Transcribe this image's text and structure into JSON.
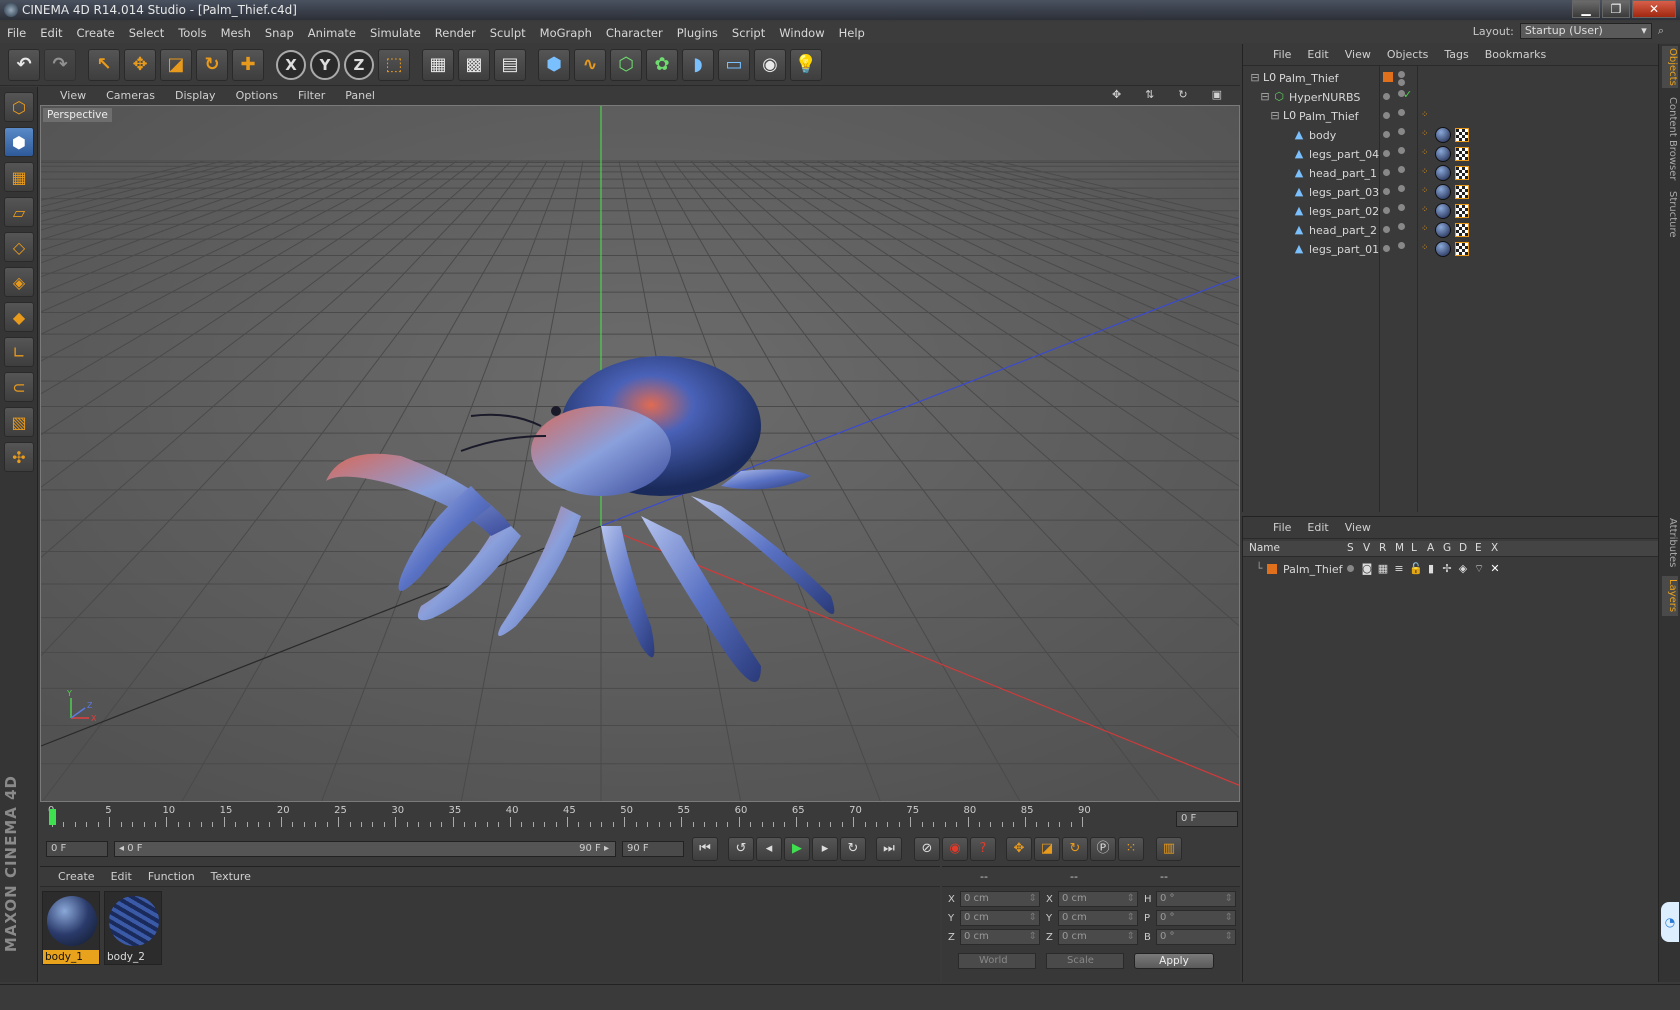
{
  "window": {
    "title": "CINEMA 4D R14.014 Studio - [Palm_Thief.c4d]",
    "min": "▁",
    "max": "❐",
    "close": "✕"
  },
  "menu": [
    "File",
    "Edit",
    "Create",
    "Select",
    "Tools",
    "Mesh",
    "Snap",
    "Animate",
    "Simulate",
    "Render",
    "Sculpt",
    "MoGraph",
    "Character",
    "Plugins",
    "Script",
    "Window",
    "Help"
  ],
  "layout": {
    "label": "Layout:",
    "value": "Startup (User)"
  },
  "viewport": {
    "menu": [
      "View",
      "Cameras",
      "Display",
      "Options",
      "Filter",
      "Panel"
    ],
    "camera_label": "Perspective",
    "axis_labels": {
      "x": "X",
      "y": "Y",
      "z": "Z"
    }
  },
  "timeline": {
    "ticks": [
      "0",
      "5",
      "10",
      "15",
      "20",
      "25",
      "30",
      "35",
      "40",
      "45",
      "50",
      "55",
      "60",
      "65",
      "70",
      "75",
      "80",
      "85",
      "90"
    ],
    "current_frame": "0 F",
    "start_field": "0 F",
    "range_start": "◂ 0 F",
    "range_end": "90 F ▸",
    "end_field": "90 F"
  },
  "materials": {
    "menu": [
      "Create",
      "Edit",
      "Function",
      "Texture"
    ],
    "items": [
      {
        "name": "body_1",
        "selected": true
      },
      {
        "name": "body_2",
        "selected": false
      }
    ]
  },
  "coordinates": {
    "headers": [
      "--",
      "--",
      "--"
    ],
    "rows": [
      {
        "a1": "X",
        "v1": "0 cm",
        "a2": "X",
        "v2": "0 cm",
        "a3": "H",
        "v3": "0 °"
      },
      {
        "a1": "Y",
        "v1": "0 cm",
        "a2": "Y",
        "v2": "0 cm",
        "a3": "P",
        "v3": "0 °"
      },
      {
        "a1": "Z",
        "v1": "0 cm",
        "a2": "Z",
        "v2": "0 cm",
        "a3": "B",
        "v3": "0 °"
      }
    ],
    "space": "World",
    "mode": "Scale",
    "apply": "Apply"
  },
  "objects": {
    "menu": [
      "File",
      "Edit",
      "View",
      "Objects",
      "Tags",
      "Bookmarks"
    ],
    "items": [
      {
        "name": "Palm_Thief",
        "type": "null"
      },
      {
        "name": "HyperNURBS",
        "type": "nurbs"
      },
      {
        "name": "Palm_Thief",
        "type": "null"
      },
      {
        "name": "body",
        "type": "poly"
      },
      {
        "name": "legs_part_04",
        "type": "poly"
      },
      {
        "name": "head_part_1",
        "type": "poly"
      },
      {
        "name": "legs_part_03",
        "type": "poly"
      },
      {
        "name": "legs_part_02",
        "type": "poly"
      },
      {
        "name": "head_part_2",
        "type": "poly"
      },
      {
        "name": "legs_part_01",
        "type": "poly"
      }
    ]
  },
  "layers": {
    "menu": [
      "File",
      "Edit",
      "View"
    ],
    "columns": [
      "Name",
      "S",
      "V",
      "R",
      "M",
      "L",
      "A",
      "G",
      "D",
      "E",
      "X"
    ],
    "items": [
      {
        "name": "Palm_Thief"
      }
    ]
  },
  "side_tabs": [
    "Objects",
    "Content Browser",
    "Structure",
    "Attributes",
    "Layers"
  ],
  "brand": "MAXON CINEMA 4D",
  "colors": {
    "accent": "#e8a21c",
    "viewport_bg": "#5b5b5b",
    "selection": "#5a8ac8"
  }
}
